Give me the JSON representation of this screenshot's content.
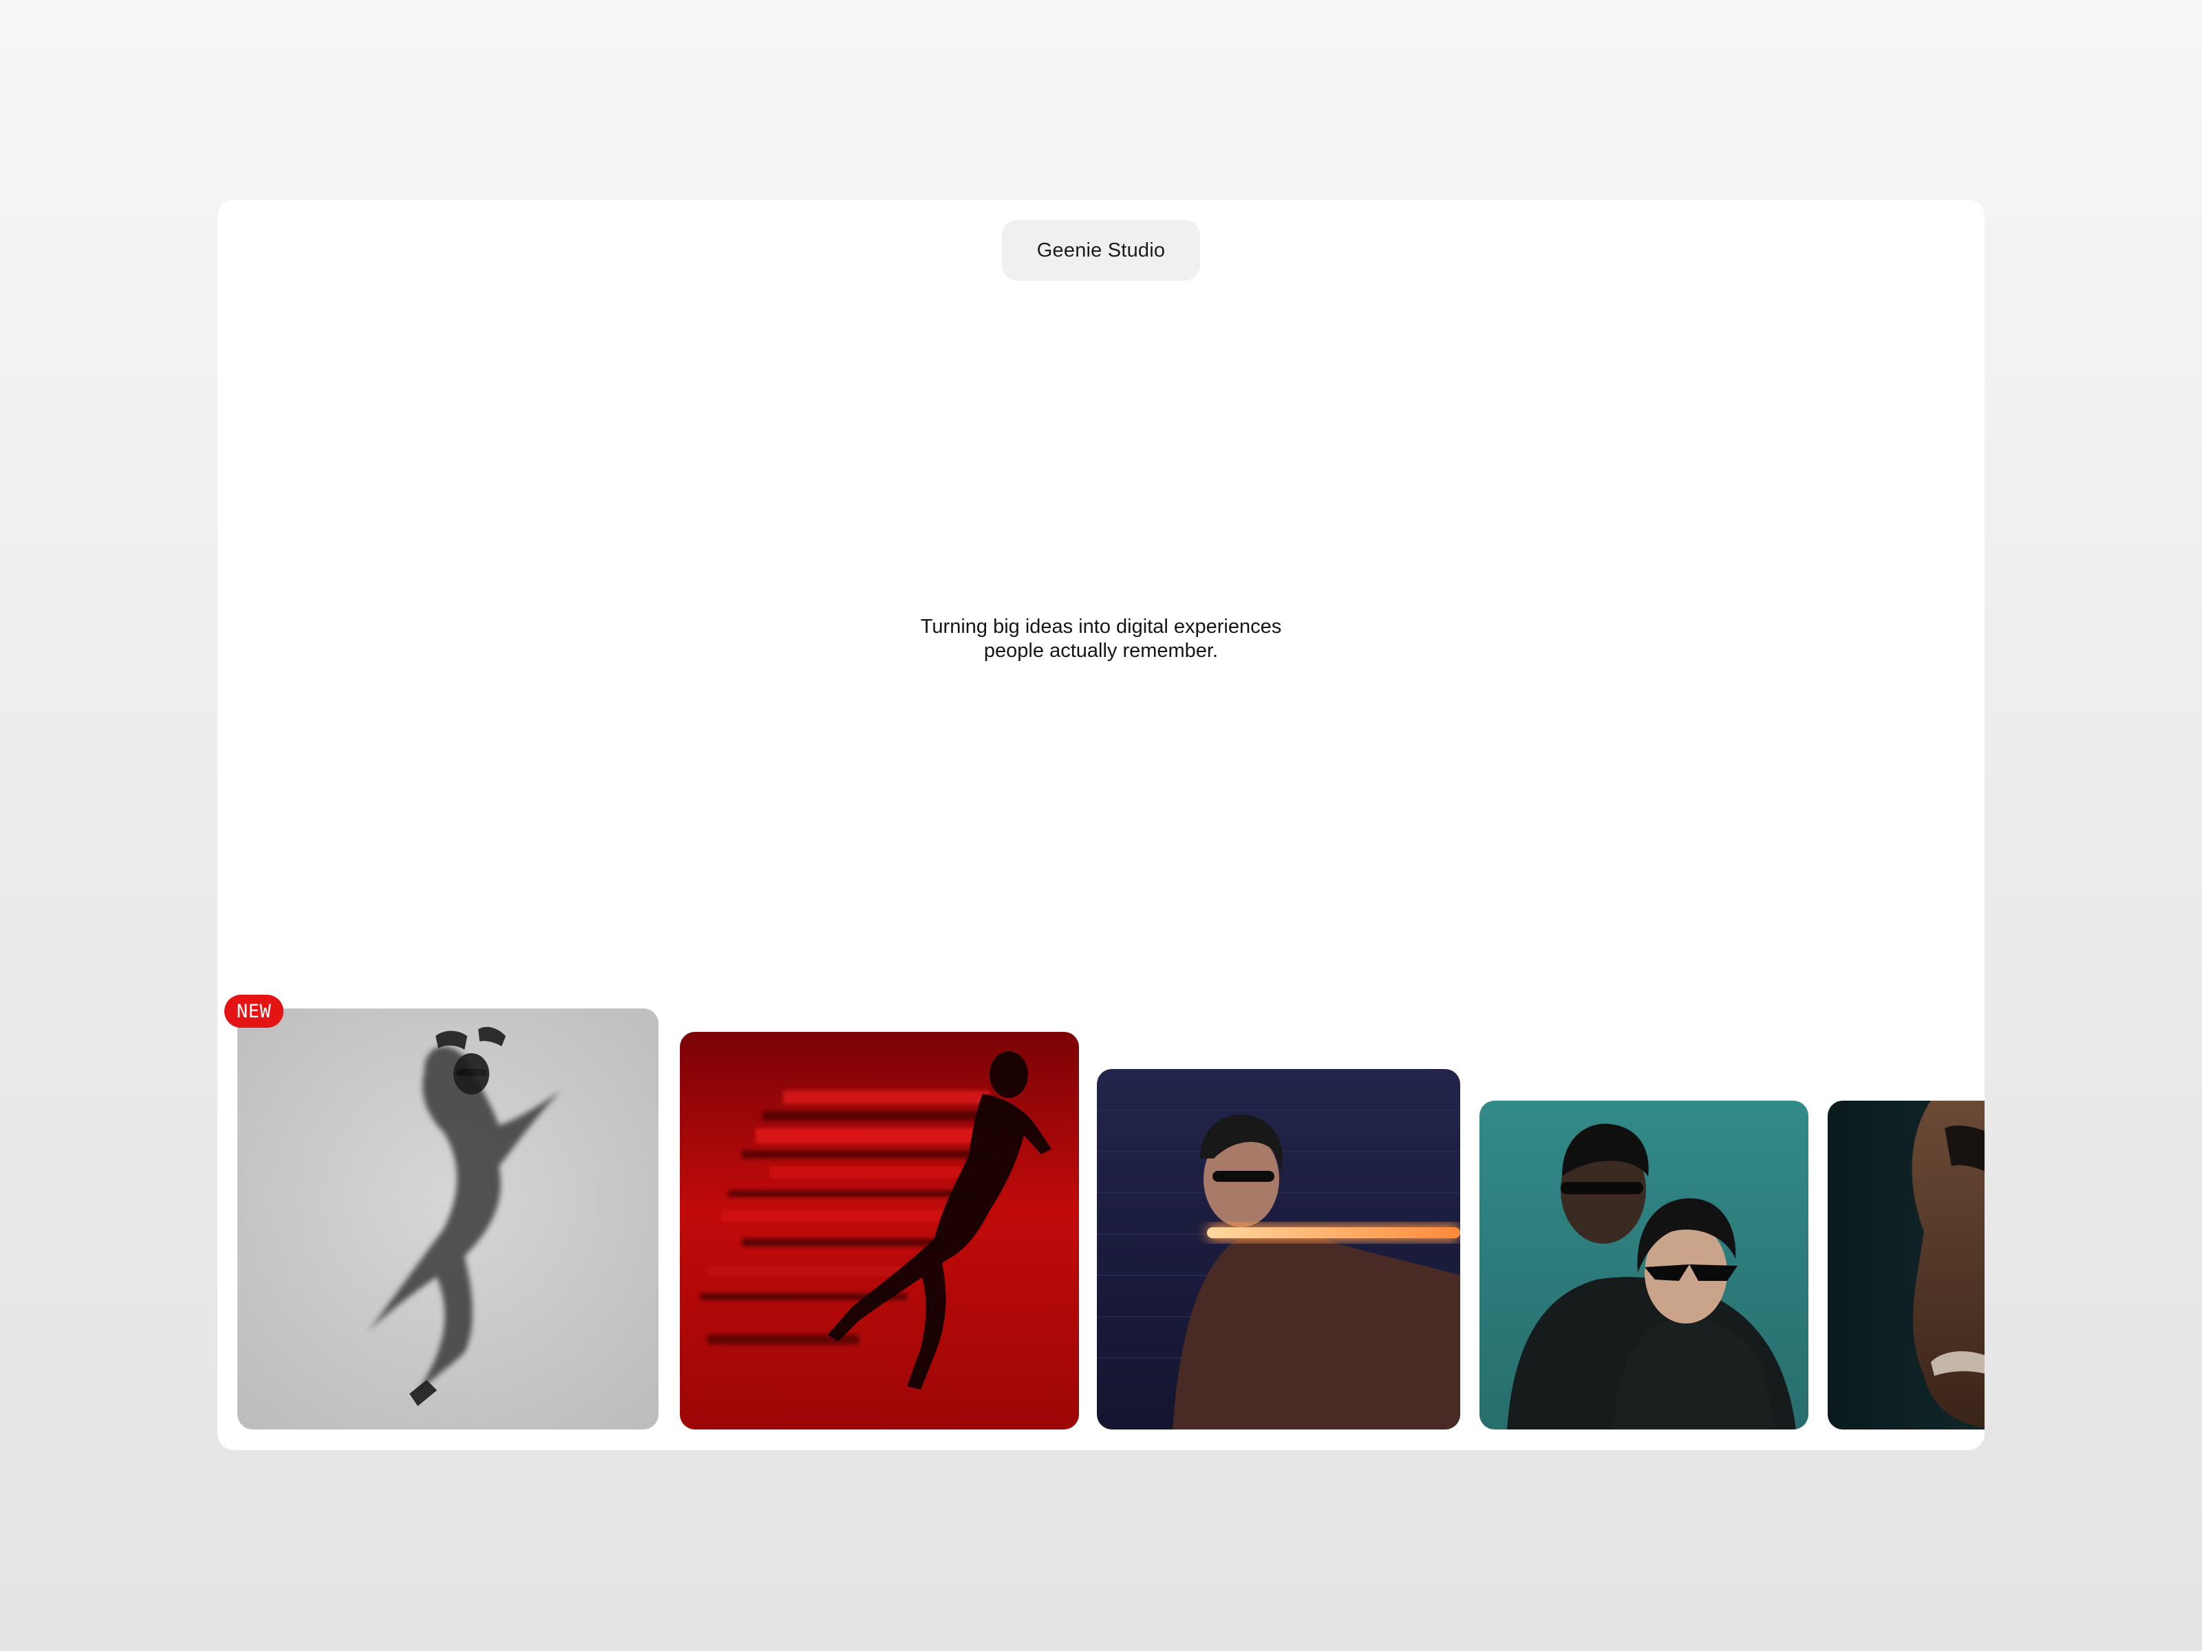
{
  "header": {
    "brand": "Geenie Studio"
  },
  "hero": {
    "tagline_line1": "Turning big ideas into digital experiences",
    "tagline_line2": "people actually remember."
  },
  "gallery": {
    "badge": "NEW",
    "items": [
      {
        "subject": "jumping figure in monochrome coat",
        "background": "#c9c9c9"
      },
      {
        "subject": "sprinting athlete with red motion blur",
        "background": "#b80808"
      },
      {
        "subject": "woman with sunglasses holding a neon light tube",
        "background": "#1b1c3a"
      },
      {
        "subject": "couple wearing sunglasses on teal background",
        "background": "#2f8584"
      },
      {
        "subject": "close-up of a partial face in shadow",
        "background": "#0a1c1f"
      }
    ]
  },
  "colors": {
    "badge": "#e51414",
    "pill": "#f0f0f0",
    "page_background": "#eeeeee"
  }
}
